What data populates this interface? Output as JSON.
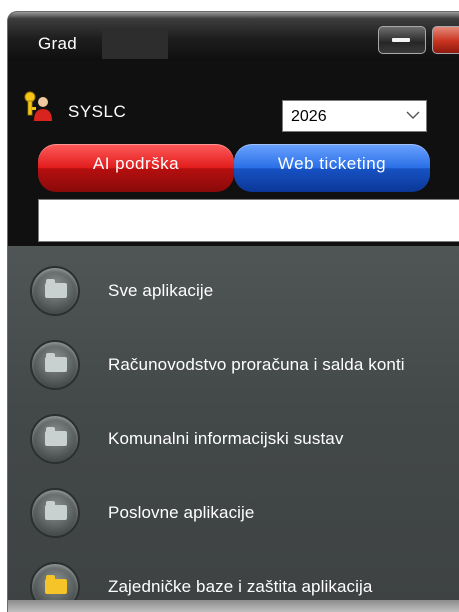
{
  "window": {
    "title": "Grad",
    "title_redacted": true
  },
  "header": {
    "app_name": "SYSLC",
    "app_icon": "user-keys-icon",
    "year_select": {
      "value": "2026",
      "icon": "chevron-down-icon"
    },
    "buttons": {
      "ai_support": "AI podrška",
      "web_ticketing": "Web ticketing"
    },
    "search": {
      "value": "",
      "placeholder": ""
    }
  },
  "applications": [
    {
      "label": "Sve aplikacije",
      "icon": "folder-icon"
    },
    {
      "label": "Računovodstvo proračuna i salda konti",
      "icon": "folder-icon"
    },
    {
      "label": "Komunalni informacijski sustav",
      "icon": "folder-icon"
    },
    {
      "label": "Poslovne aplikacije",
      "icon": "folder-icon"
    },
    {
      "label": "Zajedničke baze i zaštita aplikacija",
      "icon": "folder-open-icon"
    }
  ],
  "colors": {
    "ai_button": "#d01515",
    "web_button": "#1f5fd6",
    "window_bg": "#101010",
    "panel_bg": "#474b4b",
    "close_button": "#c8321f"
  }
}
